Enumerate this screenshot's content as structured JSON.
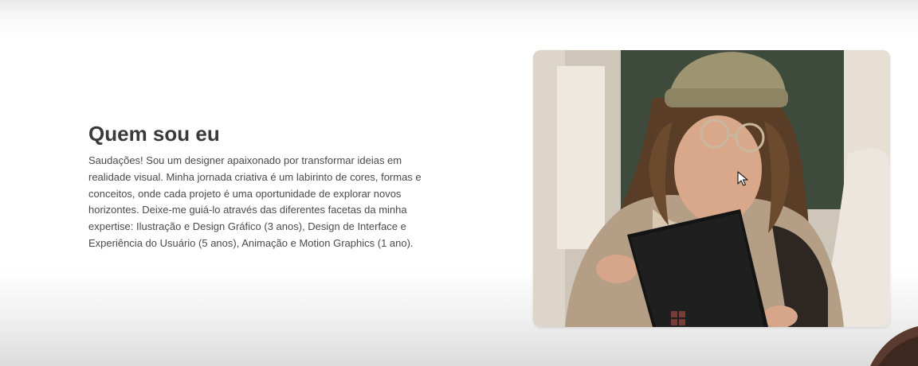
{
  "about": {
    "title": "Quem sou eu",
    "body": "Saudações! Sou um designer apaixonado por transformar ideias em realidade visual. Minha jornada criativa é um labirinto de cores, formas e conceitos, onde cada projeto é uma oportunidade de explorar novos horizontes. Deixe-me guiá-lo através das diferentes facetas da minha expertise: Ilustração e Design Gráfico (3 anos), Design de Interface e Experiência do Usuário (5 anos), Animação e Motion Graphics (1 ano)."
  },
  "colors": {
    "title_text": "#3a3a3a",
    "body_text": "#4a4a4a",
    "corner_accent": "#5a3a2e"
  },
  "icons": {
    "cursor": "mouse-pointer-icon"
  }
}
